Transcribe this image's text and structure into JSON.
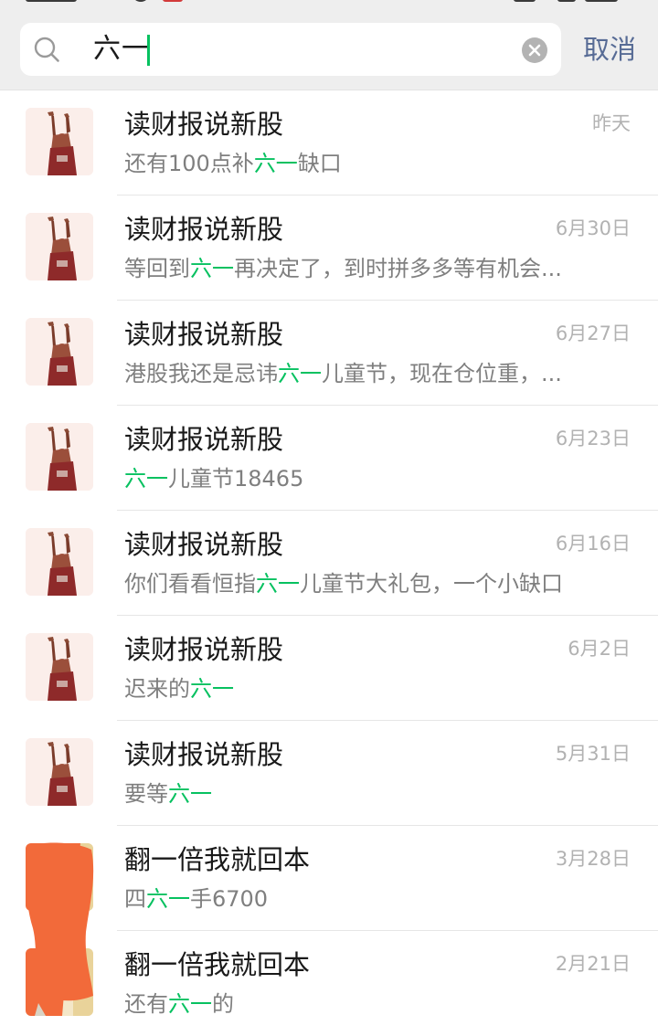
{
  "search": {
    "query": "六一",
    "cancel_label": "取消"
  },
  "results": [
    {
      "name": "读财报说新股",
      "date": "昨天",
      "before": "还有100点补",
      "match": "六一",
      "after": "缺口",
      "avatar": "person"
    },
    {
      "name": "读财报说新股",
      "date": "6月30日",
      "before": "等回到",
      "match": "六一",
      "after": "再决定了，到时拼多多等有机会...",
      "avatar": "person"
    },
    {
      "name": "读财报说新股",
      "date": "6月27日",
      "before": "港股我还是忌讳",
      "match": "六一",
      "after": "儿童节，现在仓位重，...",
      "avatar": "person"
    },
    {
      "name": "读财报说新股",
      "date": "6月23日",
      "before": "",
      "match": "六一",
      "after": "儿童节18465",
      "avatar": "person"
    },
    {
      "name": "读财报说新股",
      "date": "6月16日",
      "before": "你们看看恒指",
      "match": "六一",
      "after": "儿童节大礼包，一个小缺口",
      "avatar": "person"
    },
    {
      "name": "读财报说新股",
      "date": "6月2日",
      "before": "迟来的",
      "match": "六一",
      "after": "",
      "avatar": "person"
    },
    {
      "name": "读财报说新股",
      "date": "5月31日",
      "before": "要等",
      "match": "六一",
      "after": "",
      "avatar": "person"
    },
    {
      "name": "翻一倍我就回本",
      "date": "3月28日",
      "before": "四",
      "match": "六一",
      "after": "手6700",
      "avatar": "redacted"
    },
    {
      "name": "翻一倍我就回本",
      "date": "2月21日",
      "before": "还有",
      "match": "六一",
      "after": "的",
      "avatar": "redacted"
    }
  ],
  "colors": {
    "accent": "#07c160",
    "cancel": "#576b95",
    "redaction": "#f26a3a"
  }
}
